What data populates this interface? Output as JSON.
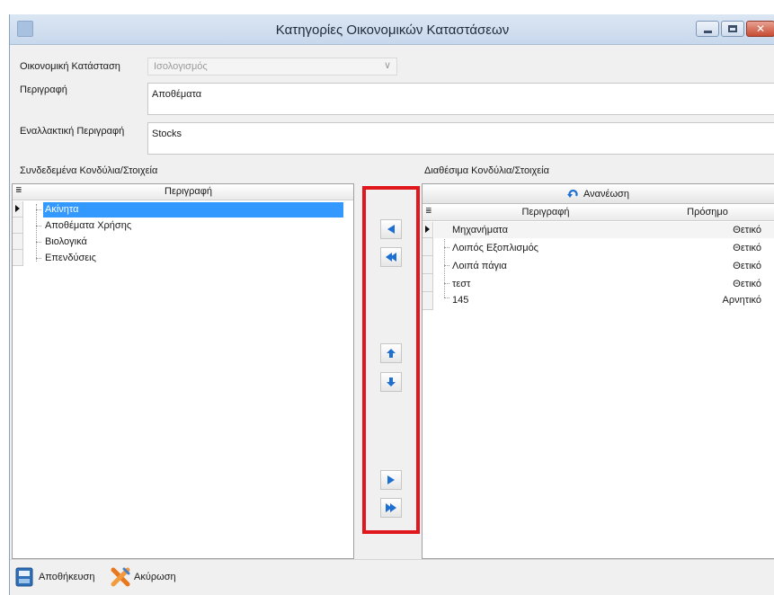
{
  "window": {
    "title": "Κατηγορίες Οικονομικών Καταστάσεων",
    "close_glyph": "✕"
  },
  "form": {
    "financial_statement_label": "Οικονομική Κατάσταση",
    "financial_statement_value": "Ισολογισμός",
    "description_label": "Περιγραφή",
    "description_value": "Αποθέματα",
    "alt_description_label": "Εναλλακτική Περιγραφή",
    "alt_description_value": "Stocks"
  },
  "linked": {
    "heading": "Συνδεδεμένα Κονδύλια/Στοιχεία",
    "column_description": "Περιγραφή",
    "rows": [
      "Ακίνητα",
      "Αποθέματα Χρήσης",
      "Βιολογικά",
      "Επενδύσεις"
    ]
  },
  "available": {
    "heading": "Διαθέσιμα Κονδύλια/Στοιχεία",
    "refresh_label": "Ανανέωση",
    "column_description": "Περιγραφή",
    "column_sign": "Πρόσημο",
    "rows": [
      {
        "description": "Μηχανήματα",
        "sign": "Θετικό"
      },
      {
        "description": "Λοιπός Εξοπλισμός",
        "sign": "Θετικό"
      },
      {
        "description": "Λοιπά πάγια",
        "sign": "Θετικό"
      },
      {
        "description": "τεστ",
        "sign": "Θετικό"
      },
      {
        "description": "145",
        "sign": "Αρνητικό"
      }
    ]
  },
  "footer": {
    "save_label": "Αποθήκευση",
    "cancel_label": "Ακύρωση"
  },
  "colors": {
    "selection": "#3399ff",
    "highlight_border": "#e0181e",
    "arrow_blue": "#1d6fd1"
  },
  "icons": {
    "move_left": "arrow-left-icon",
    "move_all_left": "double-arrow-left-icon",
    "move_up": "arrow-up-icon",
    "move_down": "arrow-down-icon",
    "move_right": "arrow-right-icon",
    "move_all_right": "double-arrow-right-icon",
    "refresh": "refresh-icon",
    "save": "save-icon",
    "cancel": "cancel-icon"
  }
}
